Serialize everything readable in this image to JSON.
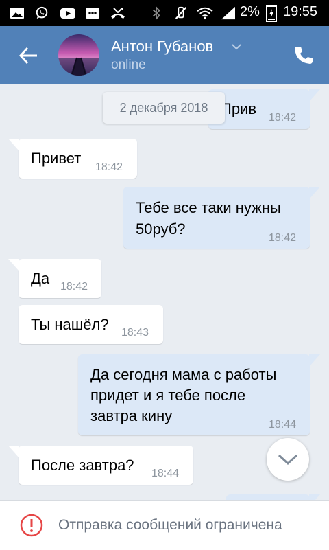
{
  "status_bar": {
    "battery_percent": "2%",
    "time": "19:55"
  },
  "header": {
    "contact_name": "Антон Губанов",
    "contact_status": "online"
  },
  "chat": {
    "date": "2 декабря 2018",
    "messages": [
      {
        "direction": "out",
        "text": "Прив",
        "time": "18:42"
      },
      {
        "direction": "in",
        "text": "Привет",
        "time": "18:42"
      },
      {
        "direction": "out",
        "lines": [
          "Тебе все таки нужны",
          "50руб?"
        ],
        "time": "18:42"
      },
      {
        "direction": "in",
        "text": "Да",
        "time": "18:42"
      },
      {
        "direction": "in",
        "text": "Ты нашёл?",
        "time": "18:43"
      },
      {
        "direction": "out",
        "lines": [
          "Да сегодня мама с работы",
          "придет и я тебе после",
          "завтра кину"
        ],
        "time": "18:44"
      },
      {
        "direction": "in",
        "text": "После завтра?",
        "time": "18:44"
      }
    ]
  },
  "footer": {
    "notice": "Отправка сообщений ограничена"
  },
  "colors": {
    "header": "#5181b8",
    "chat_background": "#e9edf2",
    "outgoing_bubble": "#dce8f7",
    "incoming_bubble": "#ffffff",
    "warning": "#e64646"
  },
  "icons": [
    "image-icon",
    "whatsapp-icon",
    "youtube-icon",
    "messenger-icon",
    "missed-call-icon",
    "bluetooth-icon",
    "mute-icon",
    "wifi-icon",
    "signal-icon",
    "battery-icon",
    "back-arrow-icon",
    "chevron-down-icon",
    "phone-icon",
    "scroll-down-icon",
    "warning-icon"
  ]
}
